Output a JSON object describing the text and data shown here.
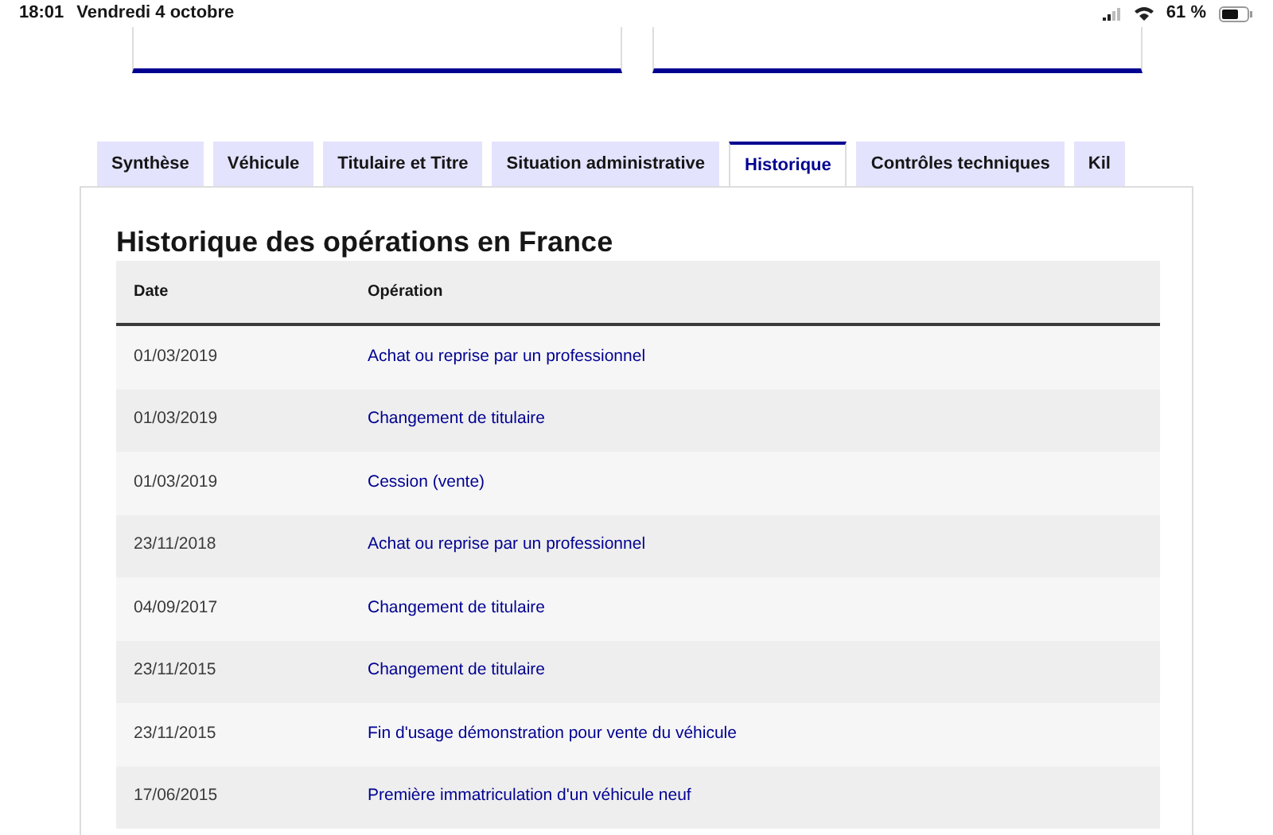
{
  "status_bar": {
    "time": "18:01",
    "date": "Vendredi 4 octobre",
    "battery": "61 %"
  },
  "tabs": [
    {
      "label": "Synthèse",
      "selected": false
    },
    {
      "label": "Véhicule",
      "selected": false
    },
    {
      "label": "Titulaire et Titre",
      "selected": false
    },
    {
      "label": "Situation administrative",
      "selected": false
    },
    {
      "label": "Historique",
      "selected": true
    },
    {
      "label": "Contrôles techniques",
      "selected": false
    },
    {
      "label": "Kil",
      "selected": false
    }
  ],
  "section_title": "Historique des opérations en France",
  "table": {
    "columns": [
      "Date",
      "Opération"
    ],
    "rows": [
      {
        "date": "01/03/2019",
        "operation": "Achat ou reprise par un professionnel"
      },
      {
        "date": "01/03/2019",
        "operation": "Changement de titulaire"
      },
      {
        "date": "01/03/2019",
        "operation": "Cession (vente)"
      },
      {
        "date": "23/11/2018",
        "operation": "Achat ou reprise par un professionnel"
      },
      {
        "date": "04/09/2017",
        "operation": "Changement de titulaire"
      },
      {
        "date": "23/11/2015",
        "operation": "Changement de titulaire"
      },
      {
        "date": "23/11/2015",
        "operation": "Fin d'usage démonstration pour vente du véhicule"
      },
      {
        "date": "17/06/2015",
        "operation": "Première immatriculation d'un véhicule neuf"
      }
    ]
  }
}
